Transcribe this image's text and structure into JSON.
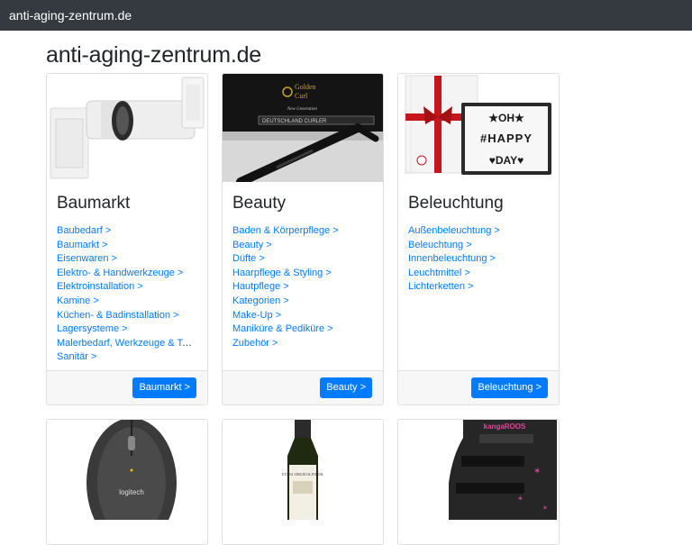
{
  "navbar": {
    "brand": "anti-aging-zentrum.de"
  },
  "page": {
    "title": "anti-aging-zentrum.de"
  },
  "categories": [
    {
      "title": "Baumarkt",
      "links": [
        "Baubedarf >",
        "Baumarkt >",
        "Eisenwaren >",
        "Elektro- & Handwerkzeuge >",
        "Elektroinstallation >",
        "Kamine >",
        "Küchen- & Badinstallation >",
        "Lagersysteme >",
        "Malerbedarf, Werkzeuge & Tapeten >",
        "Sanitär >"
      ],
      "button": "Baumarkt >"
    },
    {
      "title": "Beauty",
      "links": [
        "Baden & Körperpflege >",
        "Beauty >",
        "Düfte >",
        "Haarpflege & Styling >",
        "Hautpflege >",
        "Kategorien >",
        "Make-Up >",
        "Maniküre & Pediküre >",
        "Zubehör >"
      ],
      "button": "Beauty >",
      "image_text": {
        "brand_line1": "Golden",
        "brand_line2": "Curl",
        "tagline": "New Generation",
        "strip": "DEUTSCHLAND CURLER"
      }
    },
    {
      "title": "Beleuchtung",
      "links": [
        "Außenbeleuchtung >",
        "Beleuchtung >",
        "Innenbeleuchtung >",
        "Leuchtmittel >",
        "Lichterketten >"
      ],
      "button": "Beleuchtung >",
      "image_text": {
        "line1": "★OH★",
        "line2": "#HAPPY",
        "line3": "♥DAY♥"
      }
    }
  ],
  "row2_images": {
    "mouse_brand": "logitech",
    "bottle_label": "EXTRA VIRGIN OLIVE OIL",
    "boot_brand": "kangaROOS"
  },
  "colors": {
    "navbar": "#343a40",
    "link": "#007bff",
    "button": "#007bff",
    "footer": "#f7f7f7"
  }
}
